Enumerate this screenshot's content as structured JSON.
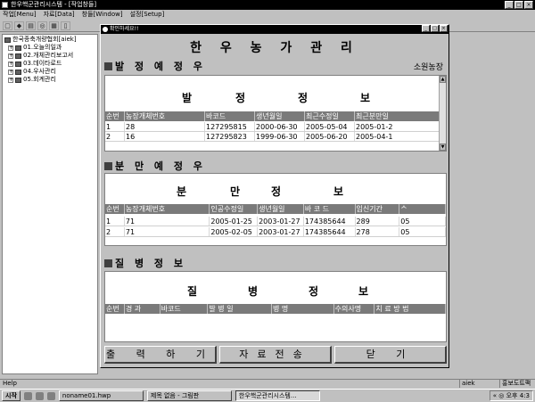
{
  "window": {
    "title": "한우핵군관리시스템 - [작업창들]",
    "controls": [
      "_",
      "□",
      "×"
    ]
  },
  "menu": [
    "작업[Menu]",
    "자료[Data]",
    "창들[Window]",
    "설정[Setup]"
  ],
  "toolbar": [
    "▢",
    "◆",
    "▤",
    "◎",
    "▦",
    "▯"
  ],
  "tree": {
    "root": "한국종축개량협회[aiek]",
    "children": [
      "01.오늘의일과",
      "02.개체관리보고서",
      "03.데이타로드",
      "04.우사관리",
      "05.회계관리"
    ]
  },
  "dialog": {
    "title": "확인하세요!!",
    "heading": "한 우 농 가 관 리",
    "farm": "소원농장",
    "sections": {
      "calving": {
        "title": "발 정 예 정 우",
        "banner": [
          "발",
          "정",
          "정",
          "보"
        ],
        "columns": [
          "순번",
          "농장개체번호",
          "바코드",
          "생년월일",
          "최근수정일",
          "최근분만일"
        ],
        "rows": [
          [
            "1",
            "28",
            "127295815",
            "2000-06-30",
            "2005-05-04",
            "2005-01-2"
          ],
          [
            "2",
            "16",
            "127295823",
            "1999-06-30",
            "2005-06-20",
            "2005-04-1"
          ]
        ]
      },
      "birth": {
        "title": "분 만 예 정 우",
        "banner": [
          "분",
          "만",
          "정",
          "보"
        ],
        "columns": [
          "순번",
          "농장개체번호",
          "인공수정일",
          "생년월일",
          "바 코 드",
          "임신기간",
          "ᄉ"
        ],
        "rows": [
          [
            "1",
            "71",
            "2005-01-25",
            "2003-01-27",
            "174385644",
            "289",
            "05"
          ],
          [
            "2",
            "71",
            "2005-02-05",
            "2003-01-27",
            "174385644",
            "278",
            "05"
          ]
        ]
      },
      "disease": {
        "title": "질 병 정 보",
        "banner": [
          "질",
          "병",
          "정",
          "보"
        ],
        "columns": [
          "순번",
          "경 과",
          "바코드",
          "발 병 일",
          "병 명",
          "수의사명",
          "치 료 방 법"
        ]
      }
    },
    "buttons": {
      "print": "출 력 하 기",
      "transfer": "자료전송",
      "close": "닫 기"
    }
  },
  "statusbar": {
    "help": "Help",
    "user": "aiek",
    "farm": "홍보도트팩"
  },
  "taskbar": {
    "start": "시작",
    "tasks": [
      "noname01.hwp",
      "제목 없음 - 그림판",
      "한우핵군관리시스템..."
    ],
    "tray": "« ◎ 오후 4:3"
  }
}
